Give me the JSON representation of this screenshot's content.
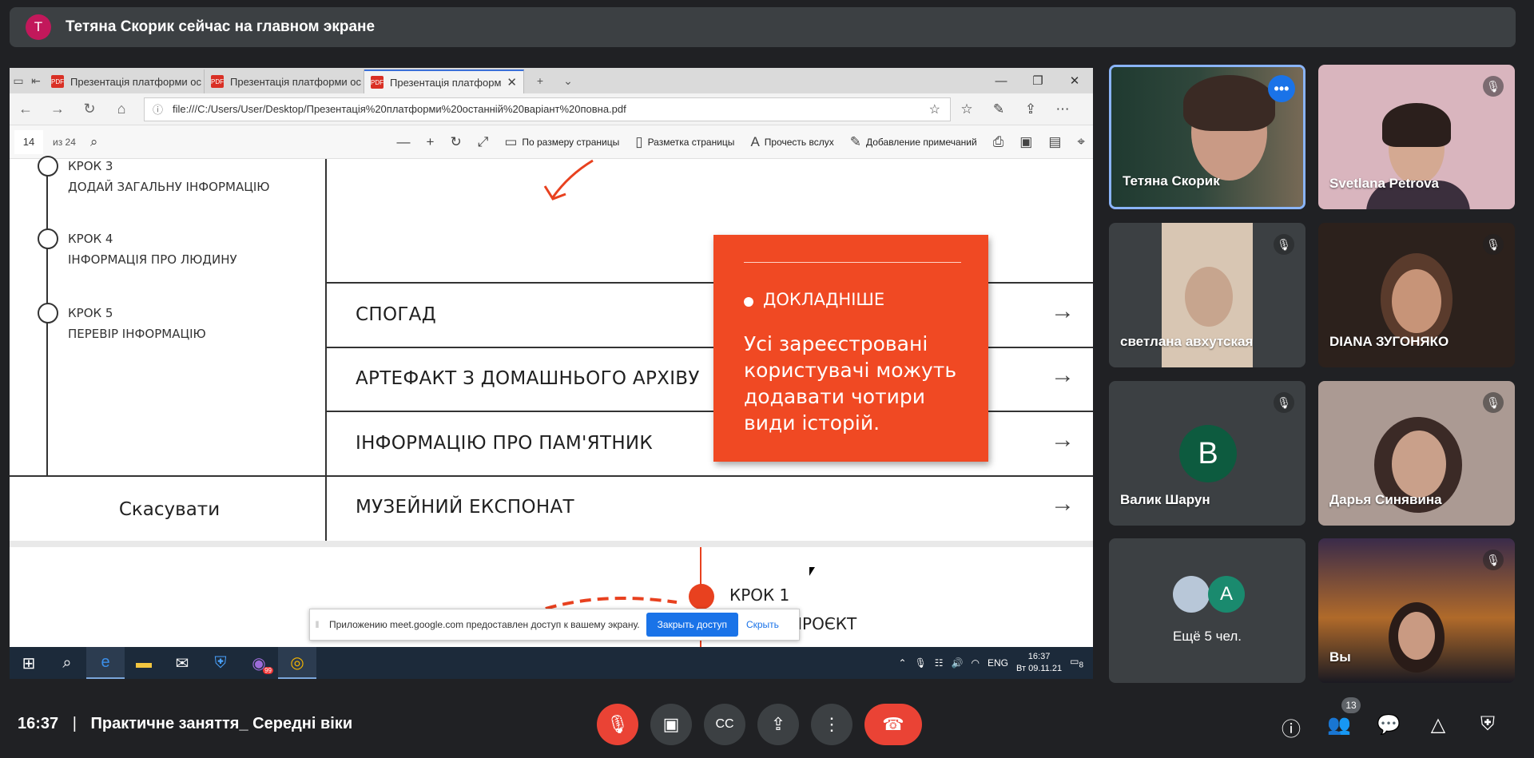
{
  "banner": {
    "avatar_letter": "T",
    "text": "Тетяна Скорик сейчас на главном экране"
  },
  "browser": {
    "tabs": [
      {
        "label": "Презентація платформи ос"
      },
      {
        "label": "Презентація платформи ос"
      },
      {
        "label": "Презентація платформ"
      }
    ],
    "url": "file:///C:/Users/User/Desktop/Презентація%20платформи%20останній%20варіант%20повна.pdf",
    "pdf_toolbar": {
      "page": "14",
      "of": "из 24",
      "fit_page": "По размеру страницы",
      "layout": "Разметка страницы",
      "read_aloud": "Прочесть вслух",
      "add_notes": "Добавление примечаний"
    }
  },
  "slide": {
    "steps": [
      {
        "title": "КРОК 3",
        "desc": "ДОДАЙ ЗАГАЛЬНУ ІНФОРМАЦІЮ"
      },
      {
        "title": "КРОК 4",
        "desc": "ІНФОРМАЦІЯ ПРО ЛЮДИНУ"
      },
      {
        "title": "КРОК 5",
        "desc": "ПЕРЕВІР ІНФОРМАЦІЮ"
      }
    ],
    "rows": [
      "СПОГАД",
      "АРТЕФАКТ З ДОМАШНЬОГО АРХІВУ",
      "ІНФОРМАЦІЮ ПРО ПАМ'ЯТНИК",
      "МУЗЕЙНИЙ ЕКСПОНАТ"
    ],
    "cancel": "Скасувати",
    "popup": {
      "heading": "ДОКЛАДНІШЕ",
      "body": "Усі зареєстровані користувачі можуть додавати чотири види історій."
    },
    "next": {
      "step": "КРОК 1",
      "text": "ПРОЄКТ"
    }
  },
  "share_bar": {
    "message": "Приложению meet.google.com предоставлен доступ к вашему экрану.",
    "stop": "Закрыть доступ",
    "hide": "Скрыть"
  },
  "taskbar": {
    "lang": "ENG",
    "time": "16:37",
    "date": "Вт 09.11.21",
    "viber_badge": "99",
    "notif": "8"
  },
  "participants": [
    {
      "name": "Тетяна Скорик"
    },
    {
      "name": "Svetlana Petrova"
    },
    {
      "name": "светлана авхутская"
    },
    {
      "name": "DIANA ЗУГОНЯКО"
    },
    {
      "name": "Валик Шарун",
      "letter": "B"
    },
    {
      "name": "Дарья Синявина"
    },
    {
      "name": "Ещё 5 чел.",
      "letter": "A"
    },
    {
      "name": "Вы"
    }
  ],
  "meeting": {
    "time": "16:37",
    "title": "Практичне заняття_ Середні віки",
    "people_count": "13"
  },
  "colors": {
    "accent": "#f04923",
    "end_call": "#ea4335",
    "bg": "#202124"
  }
}
